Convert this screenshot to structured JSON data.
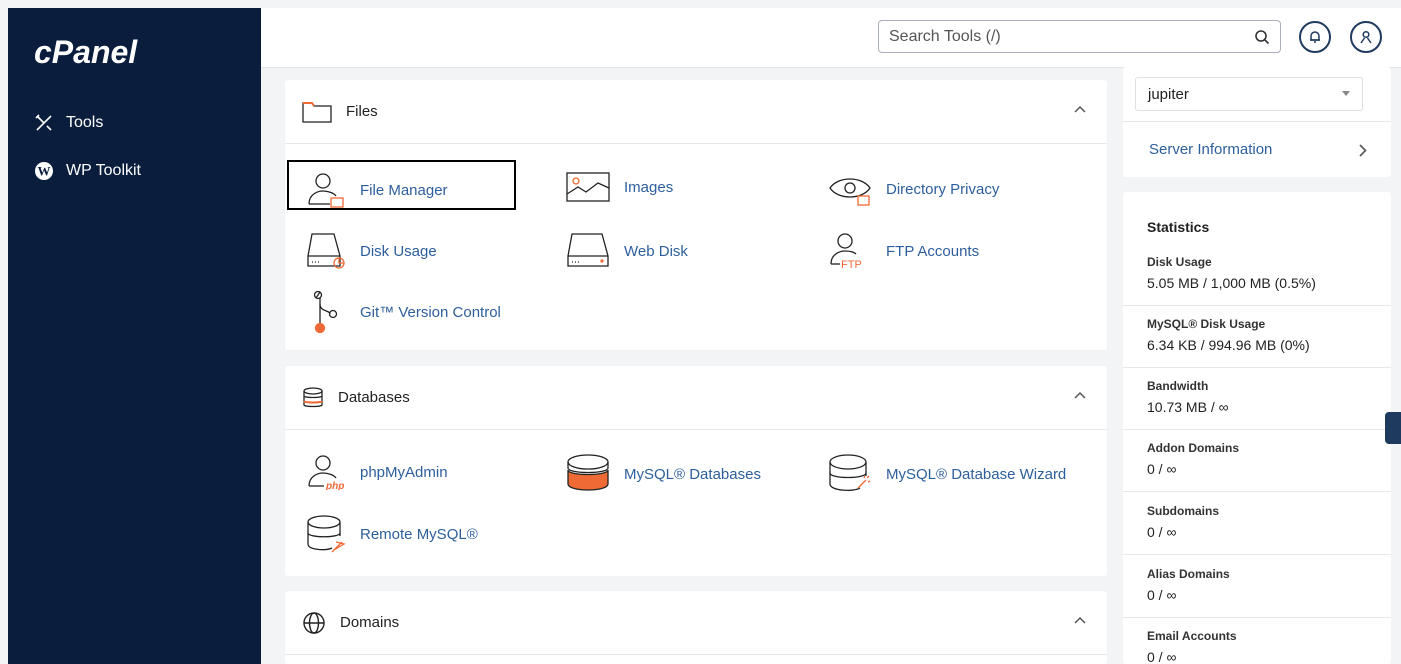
{
  "sidebar": {
    "logo_text": "cPanel",
    "items": [
      {
        "label": "Tools",
        "icon": "tools-icon"
      },
      {
        "label": "WP Toolkit",
        "icon": "wordpress-icon"
      }
    ]
  },
  "header": {
    "search_placeholder": "Search Tools (/)"
  },
  "sections": [
    {
      "title": "Files",
      "tools": [
        {
          "label": "File Manager",
          "icon": "file-manager-icon"
        },
        {
          "label": "Images",
          "icon": "images-icon"
        },
        {
          "label": "Directory Privacy",
          "icon": "directory-privacy-icon"
        },
        {
          "label": "Disk Usage",
          "icon": "disk-usage-icon"
        },
        {
          "label": "Web Disk",
          "icon": "web-disk-icon"
        },
        {
          "label": "FTP Accounts",
          "icon": "ftp-accounts-icon"
        },
        {
          "label": "Git™ Version Control",
          "icon": "git-icon"
        }
      ]
    },
    {
      "title": "Databases",
      "tools": [
        {
          "label": "phpMyAdmin",
          "icon": "phpmyadmin-icon"
        },
        {
          "label": "MySQL® Databases",
          "icon": "mysql-databases-icon"
        },
        {
          "label": "MySQL® Database Wizard",
          "icon": "mysql-wizard-icon"
        },
        {
          "label": "Remote MySQL®",
          "icon": "remote-mysql-icon"
        }
      ]
    },
    {
      "title": "Domains",
      "tools": []
    }
  ],
  "right": {
    "theme_value": "jupiter",
    "server_info_label": "Server Information",
    "stats_title": "Statistics",
    "stats": [
      {
        "label": "Disk Usage",
        "value": "5.05 MB / 1,000 MB  (0.5%)"
      },
      {
        "label": "MySQL® Disk Usage",
        "value": "6.34 KB / 994.96 MB  (0%)"
      },
      {
        "label": "Bandwidth",
        "value": "10.73 MB / ∞"
      },
      {
        "label": "Addon Domains",
        "value": "0 / ∞"
      },
      {
        "label": "Subdomains",
        "value": "0 / ∞"
      },
      {
        "label": "Alias Domains",
        "value": "0 / ∞"
      },
      {
        "label": "Email Accounts",
        "value": "0 / ∞"
      }
    ]
  },
  "colors": {
    "sidebar_bg": "#0a1d3d",
    "link": "#2d5f9c",
    "accent_orange": "#f06a35"
  }
}
